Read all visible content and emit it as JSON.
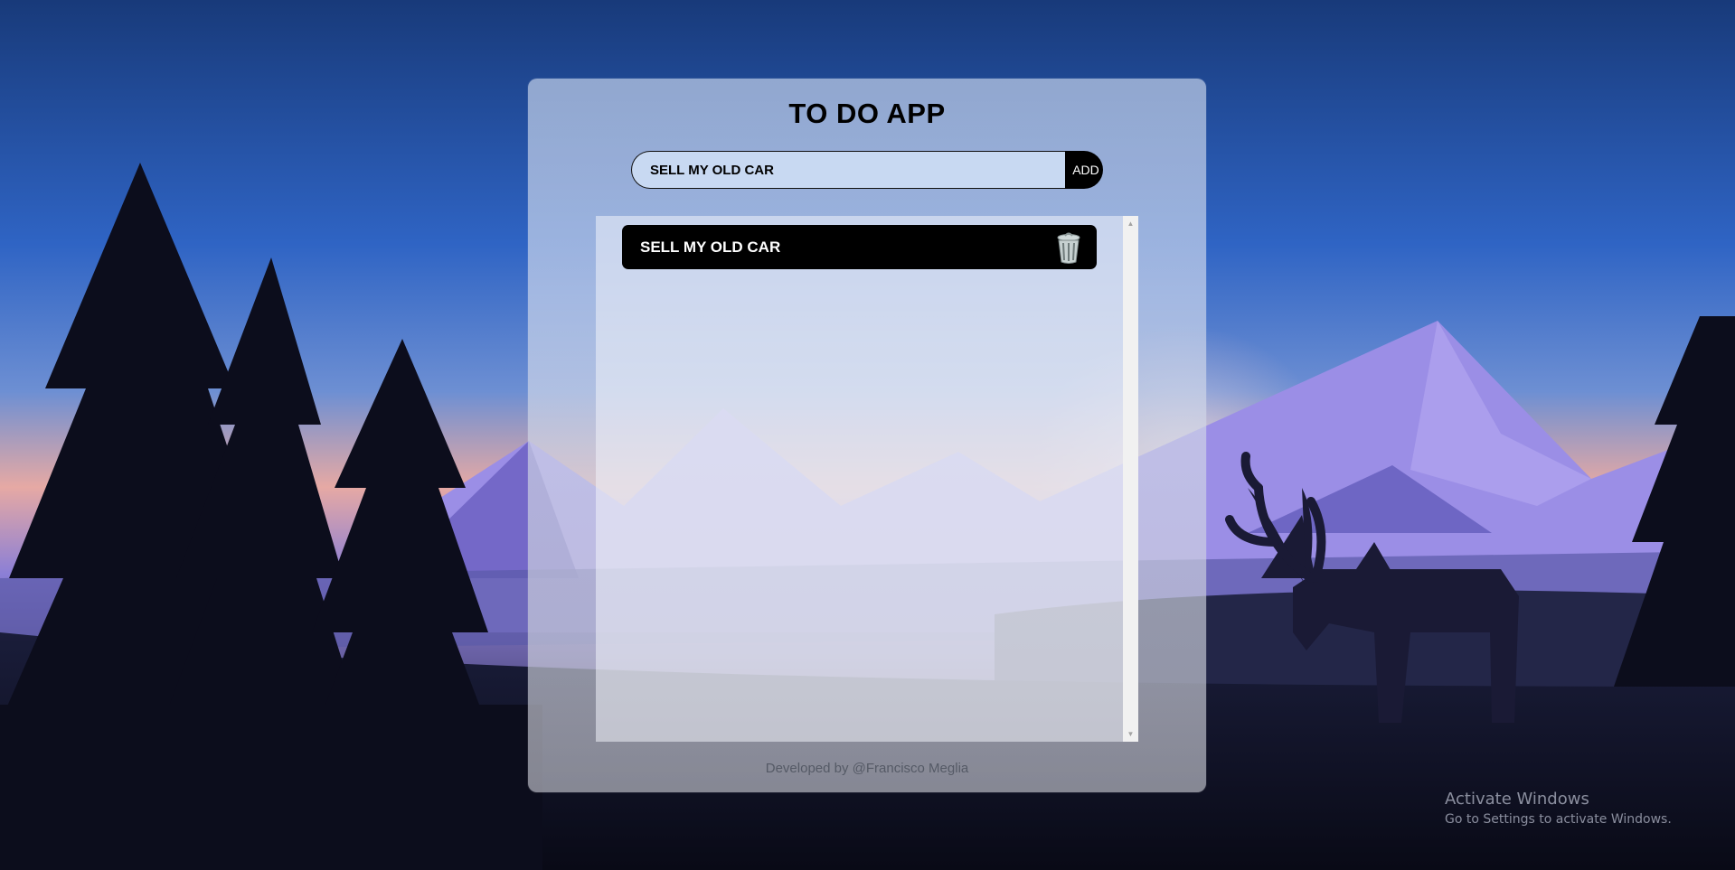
{
  "app": {
    "title": "TO DO APP"
  },
  "form": {
    "input_value": "SELL MY OLD CAR",
    "add_label": "ADD"
  },
  "tasks": [
    {
      "label": "SELL MY OLD CAR",
      "delete_icon": "trash-can-icon"
    }
  ],
  "footer": {
    "credit": "Developed by @Francisco Meglia"
  },
  "watermark": {
    "title": "Activate Windows",
    "subtitle": "Go to Settings to activate Windows."
  },
  "colors": {
    "sky_top": "#183a7a",
    "sky_mid": "#2f64c4",
    "sky_horizon": "#e6a9a4",
    "mountain": "#9b8ee6",
    "forest_dark": "#0c0d1c",
    "button_bg": "#000000",
    "task_bg": "#000000"
  }
}
